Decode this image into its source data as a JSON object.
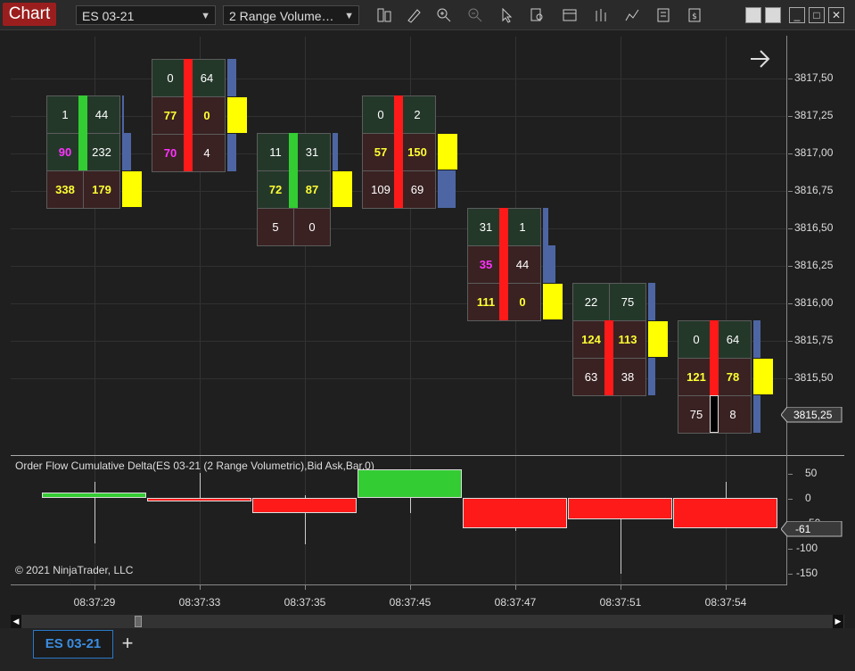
{
  "header": {
    "chart_button": "Chart",
    "instrument": "ES 03-21",
    "bar_type": "2 Range Volume…",
    "icons": [
      "data-series-icon",
      "pencil-draw-icon",
      "zoom-in-icon",
      "zoom-out-icon",
      "pointer-icon",
      "search-bars-icon",
      "chart-trader-icon",
      "bars-icon",
      "strategy-icon",
      "properties-icon"
    ],
    "window_controls": [
      "minimize",
      "maximize",
      "close"
    ]
  },
  "price_axis": {
    "labels": [
      "3817,50",
      "3817,25",
      "3817,00",
      "3816,75",
      "3816,50",
      "3816,25",
      "3816,00",
      "3815,75",
      "3815,50"
    ],
    "current_price": "3815,25"
  },
  "footprint_bars": [
    {
      "time": "08:37:29",
      "direction": "up",
      "rows": [
        [
          "1",
          "44"
        ],
        [
          "90",
          "232"
        ],
        [
          "338",
          "179"
        ]
      ],
      "colors": [
        [
          "w",
          "w"
        ],
        [
          "m",
          "w"
        ],
        [
          "y",
          "y"
        ]
      ]
    },
    {
      "time": "08:37:33",
      "direction": "down",
      "rows": [
        [
          "0",
          "64"
        ],
        [
          "77",
          "0"
        ],
        [
          "70",
          "4"
        ]
      ],
      "colors": [
        [
          "w",
          "w"
        ],
        [
          "y",
          "y"
        ],
        [
          "m",
          "w"
        ]
      ]
    },
    {
      "time": "08:37:35",
      "direction": "up",
      "rows": [
        [
          "11",
          "31"
        ],
        [
          "72",
          "87"
        ],
        [
          "5",
          "0"
        ]
      ],
      "colors": [
        [
          "w",
          "w"
        ],
        [
          "y",
          "y"
        ],
        [
          "w",
          "w"
        ]
      ]
    },
    {
      "time": "08:37:45",
      "direction": "down",
      "rows": [
        [
          "0",
          "2"
        ],
        [
          "57",
          "150"
        ],
        [
          "109",
          "69"
        ]
      ],
      "colors": [
        [
          "w",
          "w"
        ],
        [
          "y",
          "y"
        ],
        [
          "w",
          "w"
        ]
      ]
    },
    {
      "time": "08:37:47",
      "direction": "down",
      "rows": [
        [
          "31",
          "1"
        ],
        [
          "35",
          "44"
        ],
        [
          "111",
          "0"
        ]
      ],
      "colors": [
        [
          "w",
          "w"
        ],
        [
          "m",
          "w"
        ],
        [
          "y",
          "y"
        ]
      ]
    },
    {
      "time": "08:37:51",
      "direction": "down",
      "rows": [
        [
          "22",
          "75"
        ],
        [
          "124",
          "113"
        ],
        [
          "63",
          "38"
        ]
      ],
      "colors": [
        [
          "w",
          "w"
        ],
        [
          "y",
          "y"
        ],
        [
          "w",
          "w"
        ]
      ]
    },
    {
      "time": "08:37:54",
      "direction": "down",
      "rows": [
        [
          "0",
          "64"
        ],
        [
          "121",
          "78"
        ],
        [
          "75",
          "8"
        ]
      ],
      "colors": [
        [
          "w",
          "w"
        ],
        [
          "y",
          "y"
        ],
        [
          "w",
          "w"
        ]
      ]
    }
  ],
  "indicator": {
    "title": "Order Flow Cumulative Delta(ES 03-21 (2 Range Volumetric),Bid Ask,Bar,0)",
    "axis_labels": [
      "50",
      "0",
      "-50",
      "-100",
      "-150"
    ],
    "current_value": "-61",
    "copyright": "© 2021 NinjaTrader, LLC"
  },
  "time_axis": [
    "08:37:29",
    "08:37:33",
    "08:37:35",
    "08:37:45",
    "08:37:47",
    "08:37:51",
    "08:37:54"
  ],
  "tabs": {
    "active": "ES 03-21",
    "add": "+"
  },
  "colors": {
    "up": "#33cc33",
    "down": "#ff1a1a",
    "volume_profile": "#4d66a3",
    "poc": "#ffff00",
    "magenta": "#ff33ff",
    "yellow_text": "#ffff33"
  }
}
